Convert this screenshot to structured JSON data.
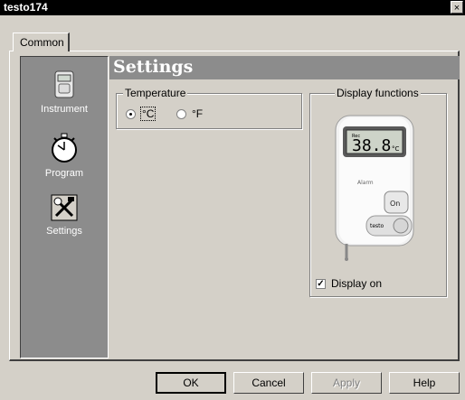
{
  "window": {
    "title": "testo174",
    "close_glyph": "×"
  },
  "tabs": [
    {
      "label": "Common"
    }
  ],
  "sidebar": {
    "items": [
      {
        "label": "Instrument",
        "icon": "instrument-icon"
      },
      {
        "label": "Program",
        "icon": "stopwatch-icon"
      },
      {
        "label": "Settings",
        "icon": "tools-icon"
      }
    ]
  },
  "main": {
    "header": "Settings",
    "temperature": {
      "label": "Temperature",
      "options": [
        {
          "label": "°C",
          "selected": true
        },
        {
          "label": "°F",
          "selected": false
        }
      ]
    },
    "display": {
      "label": "Display functions",
      "device": {
        "lcd": "38.8",
        "unit": "°C",
        "alarm": "Alarm",
        "button": "On",
        "brand": "testo"
      },
      "checkbox_label": "Display on",
      "checked": true
    }
  },
  "buttons": {
    "ok": "OK",
    "cancel": "Cancel",
    "apply": "Apply",
    "help": "Help"
  },
  "colors": {
    "sidebar": "#8c8c8c",
    "dialog": "#d4d0c8",
    "titlebar": "#000000"
  }
}
